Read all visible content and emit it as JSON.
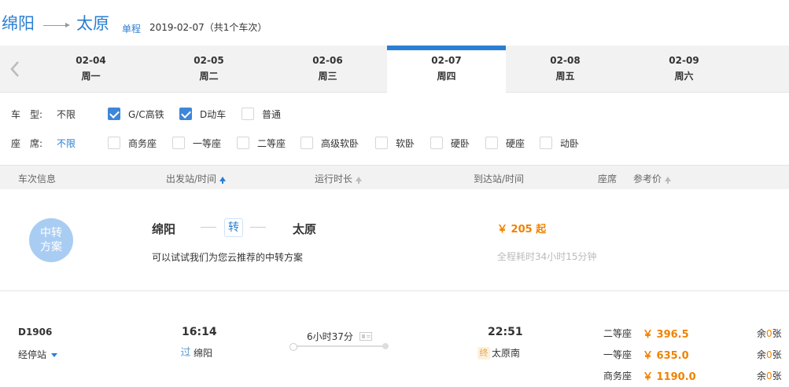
{
  "header": {
    "from": "绵阳",
    "to": "太原",
    "trip_type": "单程",
    "date_info": "2019-02-07（共1个车次）"
  },
  "date_tabs": [
    {
      "date": "02-04",
      "weekday": "周一"
    },
    {
      "date": "02-05",
      "weekday": "周二"
    },
    {
      "date": "02-06",
      "weekday": "周三"
    },
    {
      "date": "02-07",
      "weekday": "周四",
      "active": true
    },
    {
      "date": "02-08",
      "weekday": "周五"
    },
    {
      "date": "02-09",
      "weekday": "周六"
    }
  ],
  "filters": {
    "train_type": {
      "label": "车　型:",
      "value": "不限",
      "options": [
        {
          "label": "G/C高铁",
          "checked": true
        },
        {
          "label": "D动车",
          "checked": true
        },
        {
          "label": "普通",
          "checked": false
        }
      ]
    },
    "seat": {
      "label": "座　席:",
      "value": "不限",
      "options": [
        {
          "label": "商务座",
          "checked": false
        },
        {
          "label": "一等座",
          "checked": false
        },
        {
          "label": "二等座",
          "checked": false
        },
        {
          "label": "高级软卧",
          "checked": false
        },
        {
          "label": "软卧",
          "checked": false
        },
        {
          "label": "硬卧",
          "checked": false
        },
        {
          "label": "硬座",
          "checked": false
        },
        {
          "label": "动卧",
          "checked": false
        }
      ]
    }
  },
  "table_head": {
    "train_info": "车次信息",
    "departure": "出发站/时间",
    "duration": "运行时长",
    "arrival": "到达站/时间",
    "seat": "座席",
    "price": "参考价"
  },
  "transfer": {
    "badge_line1": "中转",
    "badge_line2": "方案",
    "from": "绵阳",
    "via": "转",
    "to": "太原",
    "desc": "可以试试我们为您云推荐的中转方案",
    "price": "￥ 205 起",
    "total_time": "全程耗时34小时15分钟"
  },
  "train": {
    "number": "D1906",
    "stops_label": "经停站",
    "depart_time": "16:14",
    "depart_tag": "过",
    "depart_station": "绵阳",
    "duration": "6小时37分",
    "arrive_time": "22:51",
    "arrive_tag": "终",
    "arrive_station": "太原南",
    "seats": [
      {
        "name": "二等座",
        "price": "￥ 396.5",
        "left_prefix": "余",
        "left_count": "0",
        "left_suffix": "张"
      },
      {
        "name": "一等座",
        "price": "￥ 635.0",
        "left_prefix": "余",
        "left_count": "0",
        "left_suffix": "张"
      },
      {
        "name": "商务座",
        "price": "￥ 1190.0",
        "left_prefix": "余",
        "left_count": "0",
        "left_suffix": "张"
      }
    ]
  },
  "colors": {
    "accent": "#2a7ed3",
    "price": "#f08200",
    "badge": "#a9cdf2"
  }
}
